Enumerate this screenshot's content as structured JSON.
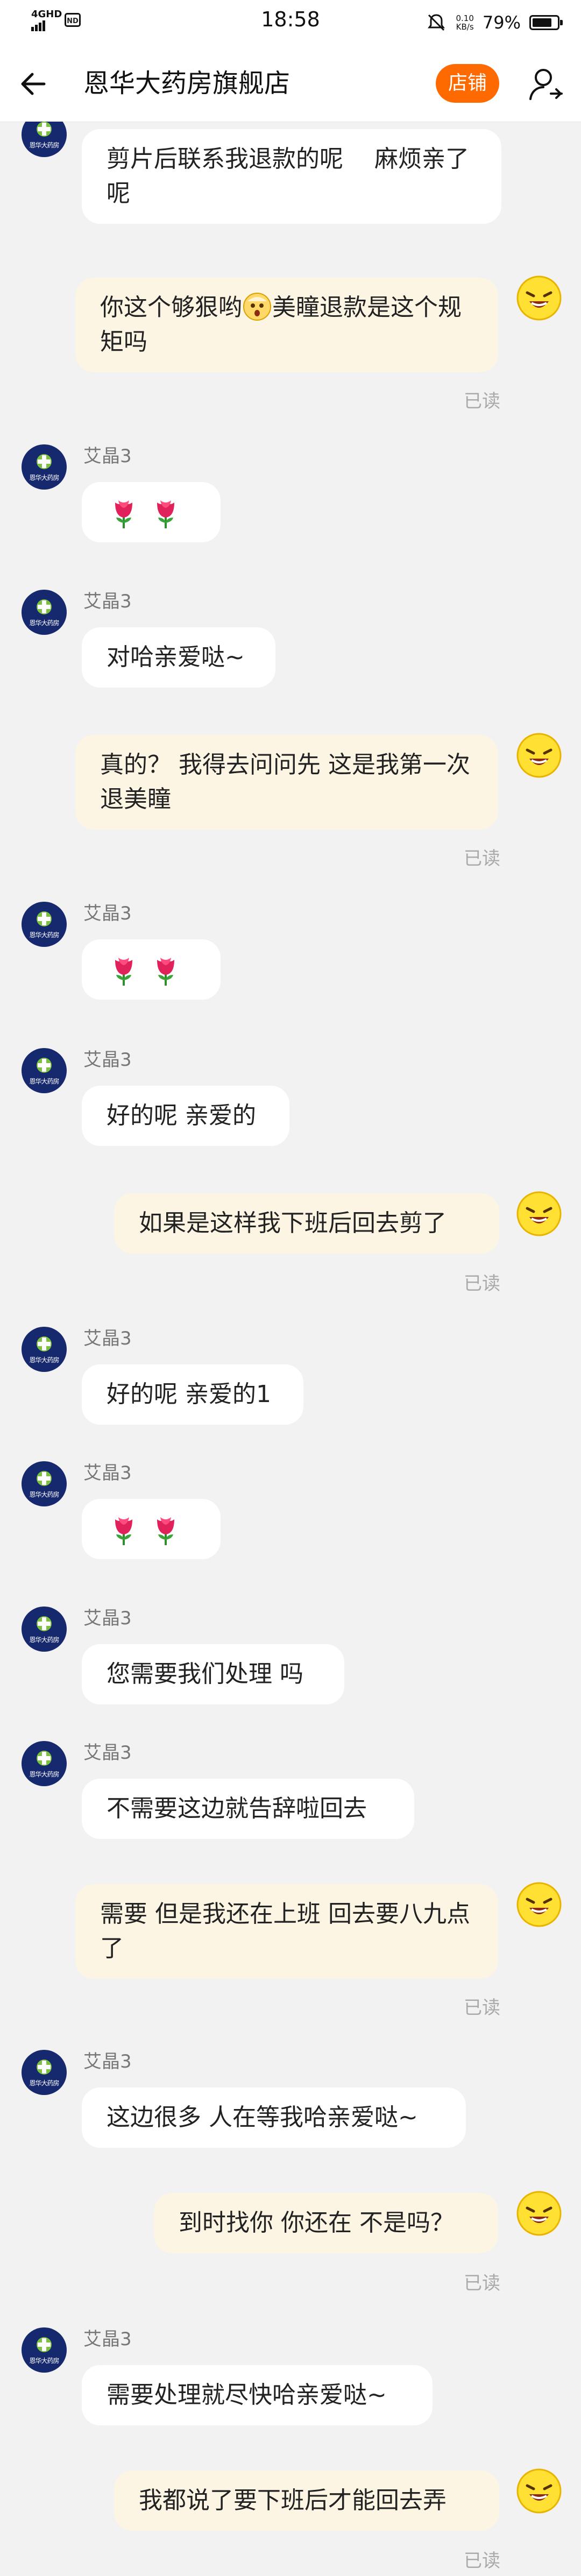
{
  "status_bar": {
    "network": "4GHD",
    "badge": "ND",
    "time": "18:58",
    "speed_top": "0.10",
    "speed_bottom": "KB/s",
    "battery_pct": "79%",
    "battery_level": 0.79
  },
  "nav": {
    "title": "恩华大药房旗舰店",
    "shop_button": "店铺"
  },
  "shop": {
    "avatar_label": "恩华大药房",
    "agent_name": "艾晶3"
  },
  "read_label": "已读",
  "messages": [
    {
      "side": "left",
      "text": "剪片后联系我退款的呢　 麻烦亲了呢"
    },
    {
      "side": "right",
      "text_before": "你这个够狠哟",
      "emoji": "surprised-face",
      "text_after": "美瞳退款是这个规矩吗",
      "status": "已读"
    },
    {
      "side": "left",
      "sender": "艾晶3",
      "type": "roses",
      "count": 2
    },
    {
      "side": "left",
      "sender": "艾晶3",
      "text": "对哈亲爱哒~"
    },
    {
      "side": "right",
      "text": "真的？ 我得去问问先 这是我第一次退美瞳",
      "status": "已读"
    },
    {
      "side": "left",
      "sender": "艾晶3",
      "type": "roses",
      "count": 2
    },
    {
      "side": "left",
      "sender": "艾晶3",
      "text": "好的呢 亲爱的"
    },
    {
      "side": "right",
      "text": "如果是这样我下班后回去剪了",
      "status": "已读"
    },
    {
      "side": "left",
      "sender": "艾晶3",
      "text": "好的呢 亲爱的1"
    },
    {
      "side": "left",
      "sender": "艾晶3",
      "type": "roses",
      "count": 2
    },
    {
      "side": "left",
      "sender": "艾晶3",
      "text": "您需要我们处理 吗"
    },
    {
      "side": "left",
      "sender": "艾晶3",
      "text": "不需要这边就告辞啦回去"
    },
    {
      "side": "right",
      "text": "需要 但是我还在上班 回去要八九点了",
      "status": "已读"
    },
    {
      "side": "left",
      "sender": "艾晶3",
      "text": "这边很多 人在等我哈亲爱哒~"
    },
    {
      "side": "right",
      "text": "到时找你 你还在 不是吗？",
      "status": "已读"
    },
    {
      "side": "left",
      "sender": "艾晶3",
      "text": "需要处理就尽快哈亲爱哒~"
    },
    {
      "side": "right",
      "text": "我都说了要下班后才能回去弄",
      "status": "已读"
    }
  ],
  "colors": {
    "accent": "#ff6a00",
    "right_bubble": "#fdf5e4",
    "left_bubble": "#ffffff",
    "background": "#f2f2f2"
  }
}
